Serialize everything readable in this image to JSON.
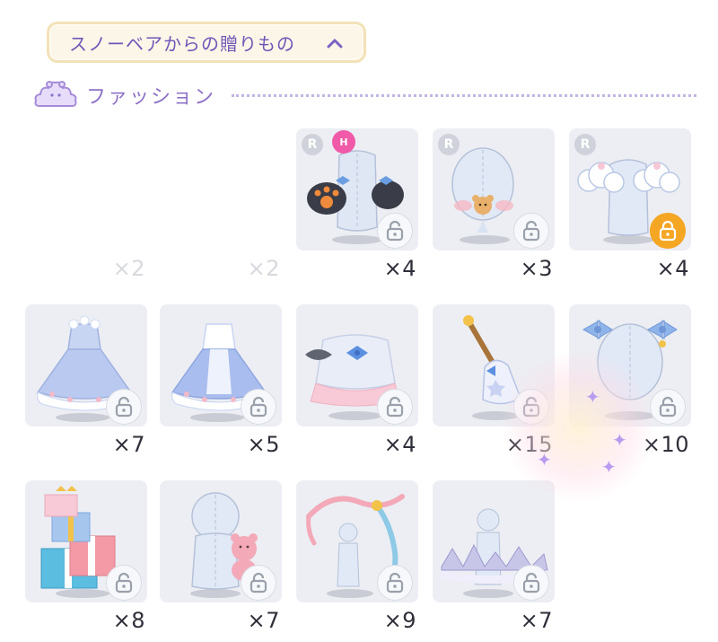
{
  "header": {
    "title": "スノーベアからの贈りもの",
    "chevron_icon": "chevron-up-icon"
  },
  "section": {
    "title": "ファッション",
    "icon": "bear-cloud-icon"
  },
  "colors": {
    "accent": "#6f57b8",
    "lock_active": "#f5a623",
    "rarity_badge": "#cfd2da"
  },
  "items": [
    {
      "count": "×2",
      "faded": true
    },
    {
      "count": "×2",
      "faded": true
    },
    {
      "count": "×4",
      "rarity": "R",
      "extra_badge": "H",
      "art": "paw-mittens"
    },
    {
      "count": "×3",
      "rarity": "R",
      "art": "bear-face-mask"
    },
    {
      "count": "×4",
      "rarity": "R",
      "art": "cloud-shoulders",
      "lock": "active"
    },
    {
      "count": "×7",
      "art": "blue-dress"
    },
    {
      "count": "×5",
      "art": "white-blue-dress"
    },
    {
      "count": "×4",
      "art": "bow-outfit"
    },
    {
      "count": "×15",
      "art": "bell-wand"
    },
    {
      "count": "×10",
      "art": "bow-hair"
    },
    {
      "count": "×8",
      "art": "gift-stack"
    },
    {
      "count": "×7",
      "art": "teddy-bear"
    },
    {
      "count": "×9",
      "art": "ribbon-swirl"
    },
    {
      "count": "×7",
      "art": "snow-floor"
    }
  ]
}
